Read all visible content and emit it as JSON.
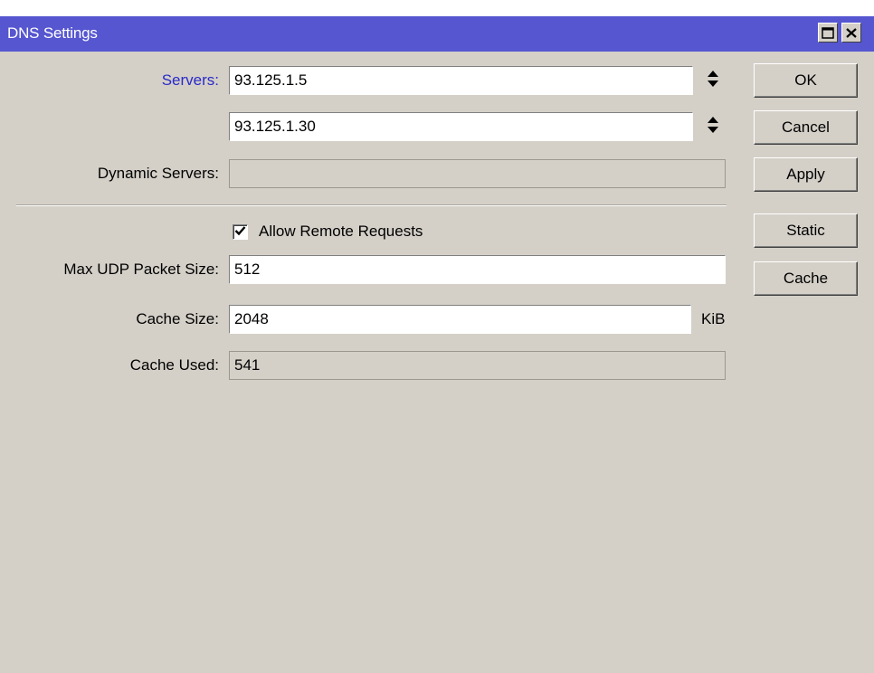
{
  "window": {
    "title": "DNS Settings"
  },
  "form": {
    "servers_label": "Servers:",
    "servers": [
      "93.125.1.5",
      "93.125.1.30"
    ],
    "dynamic_servers_label": "Dynamic Servers:",
    "dynamic_servers_value": "",
    "allow_remote_requests_label": "Allow Remote Requests",
    "allow_remote_requests_checked": true,
    "max_udp_packet_size_label": "Max UDP Packet Size:",
    "max_udp_packet_size_value": "512",
    "cache_size_label": "Cache Size:",
    "cache_size_value": "2048",
    "cache_size_unit": "KiB",
    "cache_used_label": "Cache Used:",
    "cache_used_value": "541"
  },
  "buttons": {
    "ok": "OK",
    "cancel": "Cancel",
    "apply": "Apply",
    "static": "Static",
    "cache": "Cache"
  },
  "icons": {
    "maximize": "maximize-icon",
    "close": "close-icon",
    "spinner": "up-down-arrows-icon",
    "checkmark": "checkmark-icon"
  },
  "colors": {
    "titlebar": "#5656d0",
    "window_bg": "#d4d0c8",
    "link_label": "#2a2ac8"
  }
}
